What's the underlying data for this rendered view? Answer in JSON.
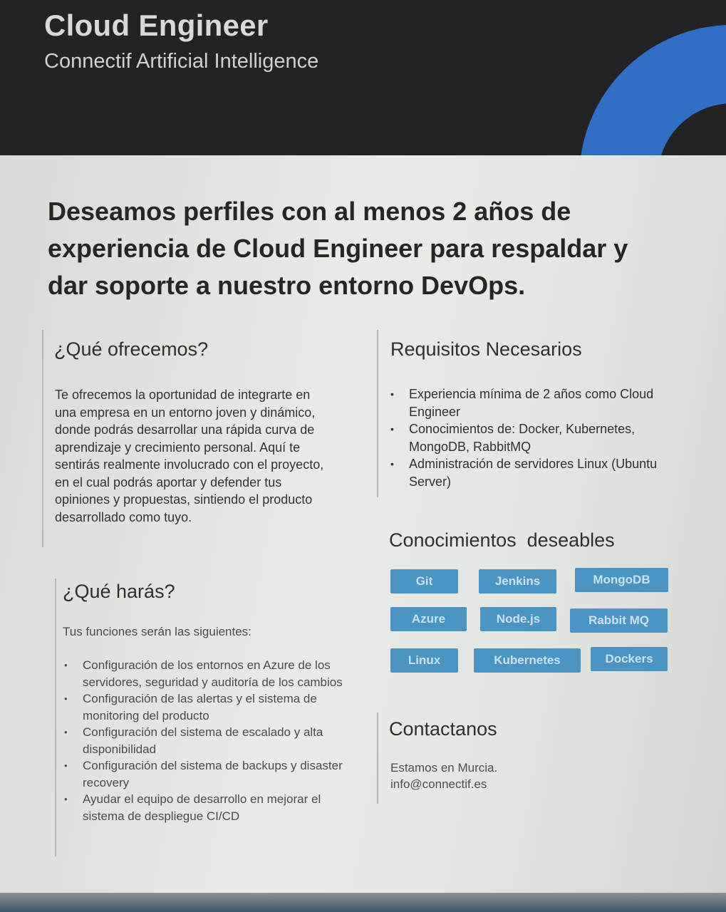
{
  "header": {
    "title": "Cloud Engineer",
    "company": "Connectif Artificial Intelligence"
  },
  "headline": "Deseamos perfiles con al menos 2 años de experiencia de Cloud Engineer para respaldar y dar soporte a nuestro entorno DevOps.",
  "offer": {
    "heading": "¿Qué ofrecemos?",
    "text": "Te ofrecemos la oportunidad de integrarte en una empresa en un entorno joven y dinámico, donde podrás desarrollar una rápida curva de aprendizaje y crecimiento personal. Aquí te sentirás realmente involucrado con el proyecto, en el cual podrás aportar y defender tus opiniones y propuestas, sintiendo el producto desarrollado como tuyo."
  },
  "requirements": {
    "heading": "Requisitos Necesarios",
    "items": [
      "Experiencia mínima de 2 años como Cloud Engineer",
      "Conocimientos de: Docker, Kubernetes, MongoDB, RabbitMQ",
      "Administración de servidores Linux (Ubuntu Server)"
    ]
  },
  "skills": {
    "heading": "Conocimientos  deseables",
    "tags": [
      "Git",
      "Jenkins",
      "MongoDB",
      "Azure",
      "Node.js",
      "Rabbit MQ",
      "Linux",
      "Kubernetes",
      "Dockers"
    ]
  },
  "tasks": {
    "heading": "¿Qué harás?",
    "intro": "Tus funciones serán las siguientes:",
    "items": [
      "Configuración de los entornos en Azure de los servidores, seguridad y auditoría de los cambios",
      "Configuración de las alertas y el sistema de monitoring del producto",
      "Configuración del sistema de escalado y alta disponibilidad",
      "Configuración del sistema de backups y disaster recovery",
      "Ayudar el equipo de desarrollo en mejorar el sistema de despliegue CI/CD"
    ]
  },
  "contact": {
    "heading": "Contactanos",
    "location": "Estamos en Murcia.",
    "email": "info@connectif.es"
  },
  "colors": {
    "header_bg": "#232325",
    "accent_blue": "#2f6fc4",
    "tag_bg": "#4b95c5"
  }
}
